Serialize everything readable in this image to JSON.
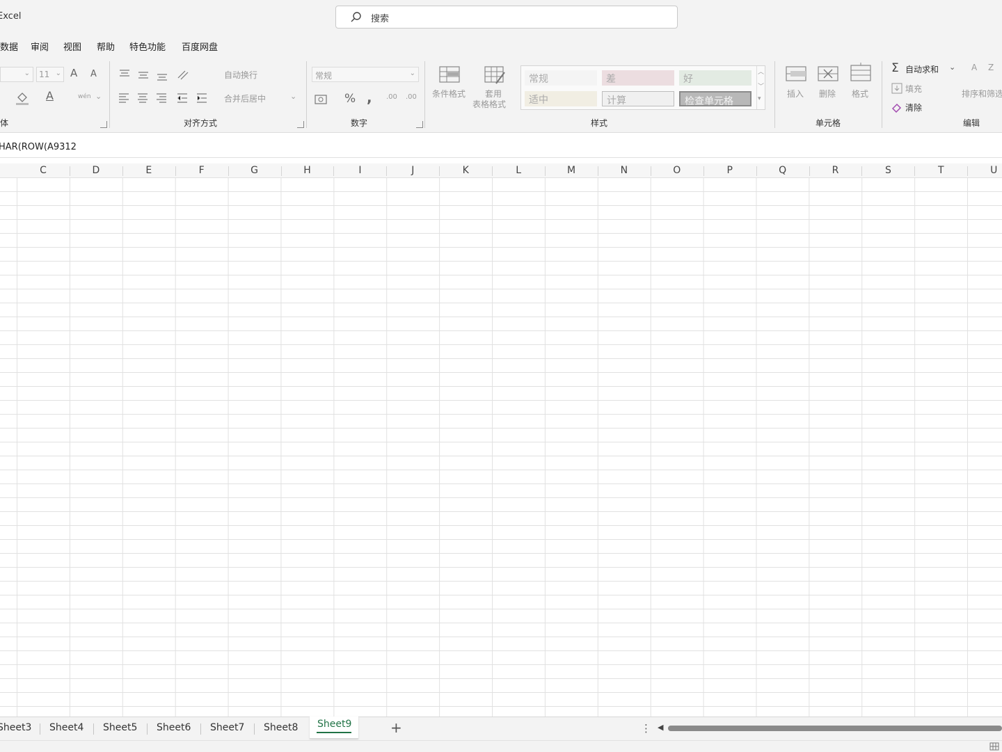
{
  "app": {
    "title": "Excel"
  },
  "search": {
    "placeholder": "搜索"
  },
  "menu": {
    "items": [
      "数据",
      "审阅",
      "视图",
      "帮助",
      "特色功能",
      "百度网盘"
    ]
  },
  "ribbon": {
    "font_group": {
      "label": "体",
      "font_size": "11",
      "grow_font": "A",
      "shrink_font": "A",
      "font_color": "A",
      "phonetic": "wén"
    },
    "align_group": {
      "label": "对齐方式",
      "wrap": "自动换行",
      "merge": "合并后居中"
    },
    "number_group": {
      "label": "数字",
      "format": "常规",
      "percent": "%",
      "comma": ",",
      "inc_decimal": ".00",
      "dec_decimal": ".00"
    },
    "styles_group": {
      "label": "样式",
      "conditional": "条件格式",
      "table_format_1": "套用",
      "table_format_2": "表格格式",
      "cells": [
        "常规",
        "差",
        "好",
        "适中",
        "计算",
        "检查单元格"
      ]
    },
    "cells_group": {
      "label": "单元格",
      "insert": "插入",
      "delete": "删除",
      "format": "格式"
    },
    "edit_group": {
      "label": "编辑",
      "autosum": "自动求和",
      "fill": "填充",
      "clear": "清除",
      "sort": "排序和筛选",
      "sigma": "Σ",
      "sort_glyph": "A Z"
    }
  },
  "formula_bar": {
    "text": "HAR(ROW(A9312"
  },
  "columns": [
    "C",
    "D",
    "E",
    "F",
    "G",
    "H",
    "I",
    "J",
    "K",
    "L",
    "M",
    "N",
    "O",
    "P",
    "Q",
    "R",
    "S",
    "T",
    "U"
  ],
  "sheets": {
    "tabs": [
      "Sheet3",
      "Sheet4",
      "Sheet5",
      "Sheet6",
      "Sheet7",
      "Sheet8",
      "Sheet9"
    ],
    "active": "Sheet9",
    "add_label": "+"
  },
  "colors": {
    "accent": "#217346",
    "chrome": "#f3f3f3",
    "grid": "#e1e1e1"
  }
}
